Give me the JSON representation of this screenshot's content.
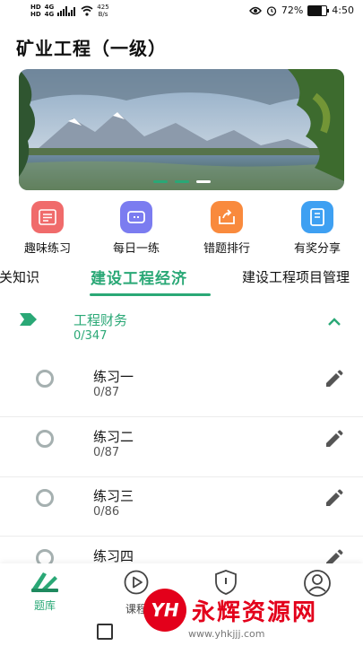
{
  "status_bar": {
    "hd1": "HD",
    "hd2": "HD",
    "net1": "4G",
    "net2": "4G",
    "speed_value": "425",
    "speed_unit": "B/s",
    "battery": "72%",
    "battery_level": 0.72,
    "time": "4:50"
  },
  "header": {
    "title": "矿业工程（一级）"
  },
  "banner": {
    "page_count": 3,
    "active_index": 2
  },
  "quick_actions": [
    {
      "label": "趣味练习",
      "color": "#f06b6b",
      "icon": "list-icon"
    },
    {
      "label": "每日一练",
      "color": "#7b7cf0",
      "icon": "box-icon"
    },
    {
      "label": "错题排行",
      "color": "#f98a3d",
      "icon": "share-box-icon"
    },
    {
      "label": "有奖分享",
      "color": "#3ea0f2",
      "icon": "notebook-icon"
    }
  ],
  "tabs": [
    {
      "label": "相关知识",
      "active": false
    },
    {
      "label": "建设工程经济",
      "active": true
    },
    {
      "label": "建设工程项目管理",
      "active": false
    }
  ],
  "section": {
    "title": "工程财务",
    "count": "0/347",
    "accent": "#2aa876"
  },
  "exercises": [
    {
      "name": "练习一",
      "count": "0/87"
    },
    {
      "name": "练习二",
      "count": "0/87"
    },
    {
      "name": "练习三",
      "count": "0/86"
    },
    {
      "name": "练习四",
      "count": ""
    }
  ],
  "bottom_nav": [
    {
      "label": "题库",
      "icon": "books-icon",
      "active": true
    },
    {
      "label": "课程",
      "icon": "play-circle-icon",
      "active": false
    },
    {
      "label": "",
      "icon": "shield-icon",
      "active": false
    },
    {
      "label": "",
      "icon": "user-icon",
      "active": false
    }
  ],
  "watermark": {
    "logo_text": "YH",
    "text": "永辉资源网",
    "url": "www.yhkjjj.com"
  }
}
